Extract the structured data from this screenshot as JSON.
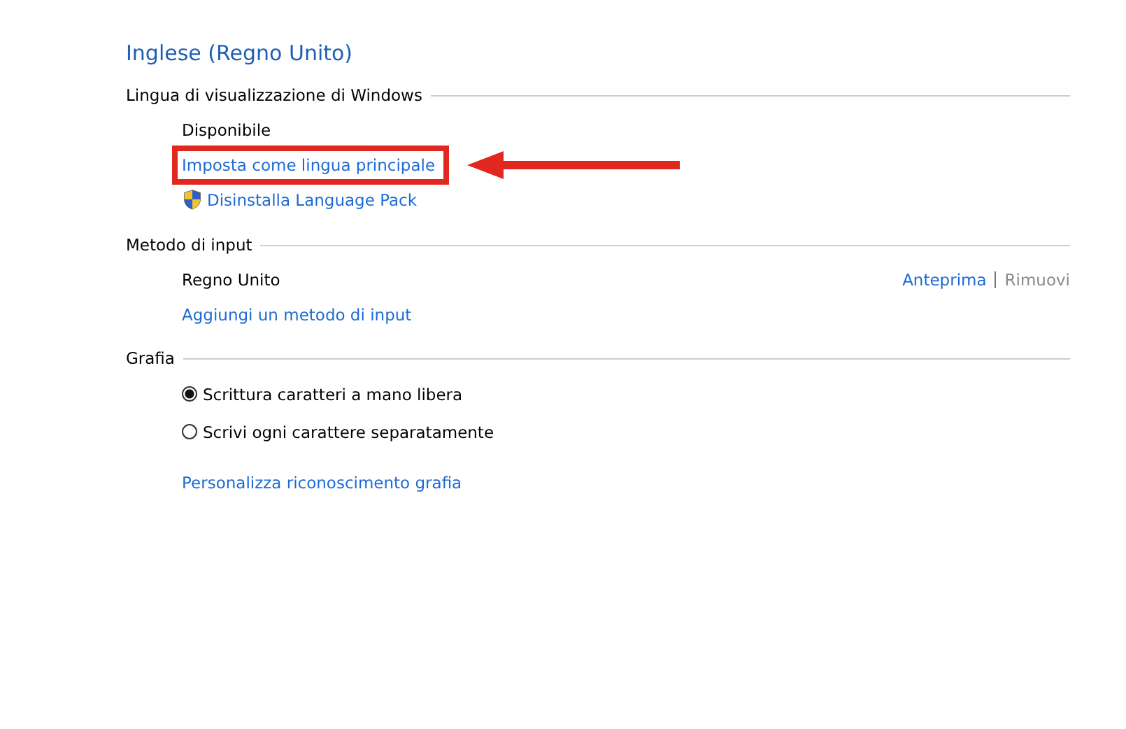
{
  "title": "Inglese (Regno Unito)",
  "display_language": {
    "heading": "Lingua di visualizzazione di Windows",
    "status": "Disponibile",
    "links": [
      {
        "label": "Imposta come lingua principale",
        "highlighted": true,
        "shield": false
      },
      {
        "label": "Disinstalla Language Pack",
        "highlighted": false,
        "shield": true
      }
    ]
  },
  "input_method": {
    "heading": "Metodo di input",
    "methods": [
      {
        "name": "Regno Unito",
        "actions": [
          {
            "label": "Anteprima",
            "disabled": false
          },
          {
            "label": "Rimuovi",
            "disabled": true
          }
        ]
      }
    ],
    "add_link": "Aggiungi un metodo di input"
  },
  "handwriting": {
    "heading": "Grafia",
    "options": [
      {
        "label": "Scrittura caratteri a mano libera",
        "selected": true
      },
      {
        "label": "Scrivi ogni carattere separatamente",
        "selected": false
      }
    ],
    "link": "Personalizza riconoscimento grafia"
  }
}
